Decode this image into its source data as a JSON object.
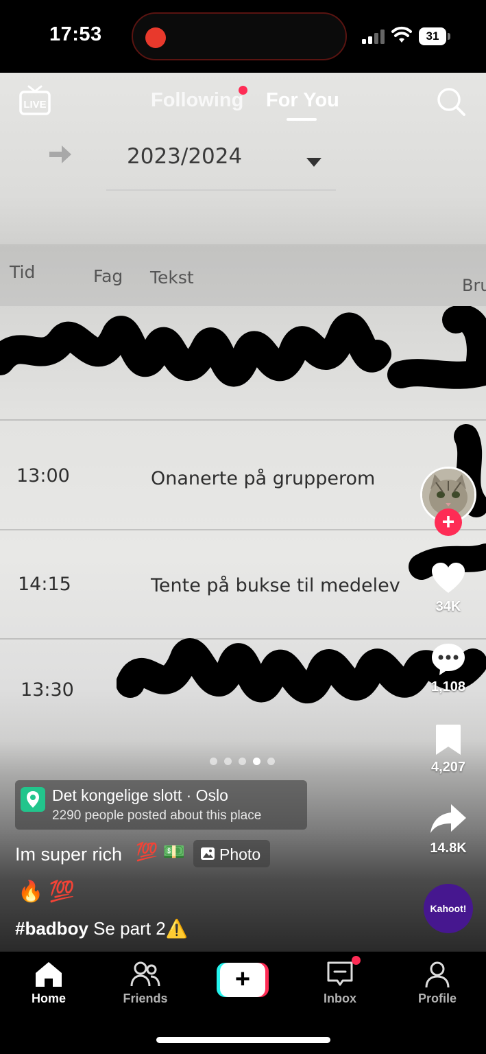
{
  "status_bar": {
    "time": "17:53",
    "battery": "31",
    "icons": [
      "recording-indicator-icon",
      "cellular-signal-icon",
      "wifi-icon",
      "battery-icon"
    ]
  },
  "top_nav": {
    "live_icon": "live-tv-icon",
    "tabs": [
      {
        "label": "Following",
        "active": false,
        "has_notification_dot": true
      },
      {
        "label": "For You",
        "active": true
      }
    ],
    "search_icon": "search-icon"
  },
  "photo_content": {
    "year_selector": "2023/2024",
    "columns": [
      "Tid",
      "Fag",
      "Tekst",
      "Bru"
    ],
    "rows": [
      {
        "time": "13:00",
        "text": "Onanerte på grupperom"
      },
      {
        "time": "14:15",
        "text": "Tente på bukse til medelev"
      },
      {
        "time": "13:30",
        "text": ""
      }
    ]
  },
  "carousel": {
    "total": 5,
    "active_index": 3
  },
  "right_rail": {
    "likes": "34K",
    "comments": "1,108",
    "bookmarks": "4,207",
    "shares": "14.8K",
    "music_badge": "Kahoot!"
  },
  "post": {
    "location": {
      "name": "Det kongelige slott · Oslo",
      "subtitle": "2290 people posted about this place"
    },
    "caption": "Im super rich",
    "caption_emoji": "💯 💵",
    "photo_chip": "Photo",
    "emoji_line": "🔥 💯",
    "hashtag": "#badboy",
    "hashtag_rest": " Se part 2⚠️"
  },
  "bottom_nav": {
    "items": [
      {
        "label": "Home",
        "icon": "home-icon",
        "active": true
      },
      {
        "label": "Friends",
        "icon": "friends-icon"
      },
      {
        "label": "",
        "icon": "create-plus-icon"
      },
      {
        "label": "Inbox",
        "icon": "inbox-icon",
        "has_notification_dot": true
      },
      {
        "label": "Profile",
        "icon": "profile-icon"
      }
    ]
  },
  "colors": {
    "accent_red": "#fe2c55",
    "accent_cyan": "#25f4ee",
    "location_pin": "#22c58c",
    "kahoot_purple": "#46178f"
  }
}
